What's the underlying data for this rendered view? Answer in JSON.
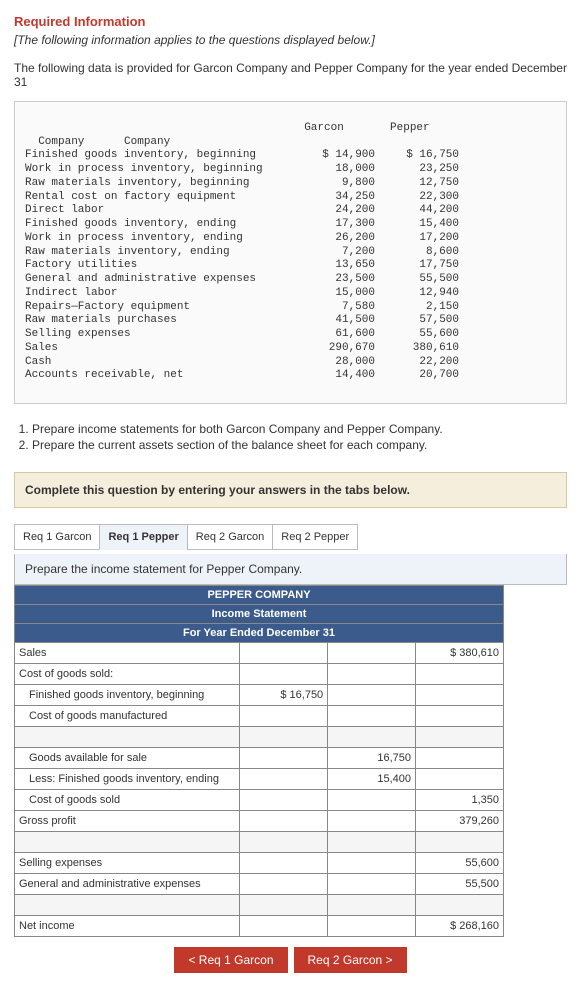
{
  "header": {
    "required": "Required Information",
    "note": "[The following information applies to the questions displayed below.]",
    "intro": "The following data is provided for Garcon Company and Pepper Company for the year ended December 31"
  },
  "data_table": {
    "col1": "Garcon\nCompany",
    "col2": "Pepper\nCompany",
    "rows": [
      {
        "label": "Finished goods inventory, beginning",
        "g": "$ 14,900",
        "p": "$ 16,750"
      },
      {
        "label": "Work in process inventory, beginning",
        "g": "18,000",
        "p": "23,250"
      },
      {
        "label": "Raw materials inventory, beginning",
        "g": "9,800",
        "p": "12,750"
      },
      {
        "label": "Rental cost on factory equipment",
        "g": "34,250",
        "p": "22,300"
      },
      {
        "label": "Direct labor",
        "g": "24,200",
        "p": "44,200"
      },
      {
        "label": "Finished goods inventory, ending",
        "g": "17,300",
        "p": "15,400"
      },
      {
        "label": "Work in process inventory, ending",
        "g": "26,200",
        "p": "17,200"
      },
      {
        "label": "Raw materials inventory, ending",
        "g": "7,200",
        "p": "8,600"
      },
      {
        "label": "Factory utilities",
        "g": "13,650",
        "p": "17,750"
      },
      {
        "label": "General and administrative expenses",
        "g": "23,500",
        "p": "55,500"
      },
      {
        "label": "Indirect labor",
        "g": "15,000",
        "p": "12,940"
      },
      {
        "label": "Repairs—Factory equipment",
        "g": "7,580",
        "p": "2,150"
      },
      {
        "label": "Raw materials purchases",
        "g": "41,500",
        "p": "57,500"
      },
      {
        "label": "Selling expenses",
        "g": "61,600",
        "p": "55,600"
      },
      {
        "label": "Sales",
        "g": "290,670",
        "p": "380,610"
      },
      {
        "label": "Cash",
        "g": "28,000",
        "p": "22,200"
      },
      {
        "label": "Accounts receivable, net",
        "g": "14,400",
        "p": "20,700"
      }
    ]
  },
  "tasks": {
    "t1": "Prepare income statements for both Garcon Company and Pepper Company.",
    "t2": "Prepare the current assets section of the balance sheet for each company."
  },
  "complete": "Complete this question by entering your answers in the tabs below.",
  "tabs": {
    "t1": "Req 1 Garcon",
    "t2": "Req 1 Pepper",
    "t3": "Req 2 Garcon",
    "t4": "Req 2 Pepper"
  },
  "instruction": "Prepare the income statement for Pepper Company.",
  "statement": {
    "h1": "PEPPER COMPANY",
    "h2": "Income Statement",
    "h3": "For Year Ended December 31",
    "rows": {
      "sales_label": "Sales",
      "sales_val": "$   380,610",
      "cogs_label": "Cost of goods sold:",
      "fgib_label": "Finished goods inventory, beginning",
      "fgib_val": "$    16,750",
      "cogm_label": "Cost of goods manufactured",
      "gafs_label": "Goods available for sale",
      "gafs_val": "16,750",
      "lfgie_label": "Less: Finished goods inventory, ending",
      "lfgie_val": "15,400",
      "cogs_sold_label": "Cost of goods sold",
      "cogs_sold_val": "1,350",
      "gp_label": "Gross profit",
      "gp_val": "379,260",
      "sell_label": "Selling expenses",
      "sell_val": "55,600",
      "ga_label": "General and administrative expenses",
      "ga_val": "55,500",
      "ni_label": "Net income",
      "ni_val": "$   268,160"
    }
  },
  "nav": {
    "prev": "<  Req 1 Garcon",
    "next": "Req 2 Garcon  >"
  }
}
